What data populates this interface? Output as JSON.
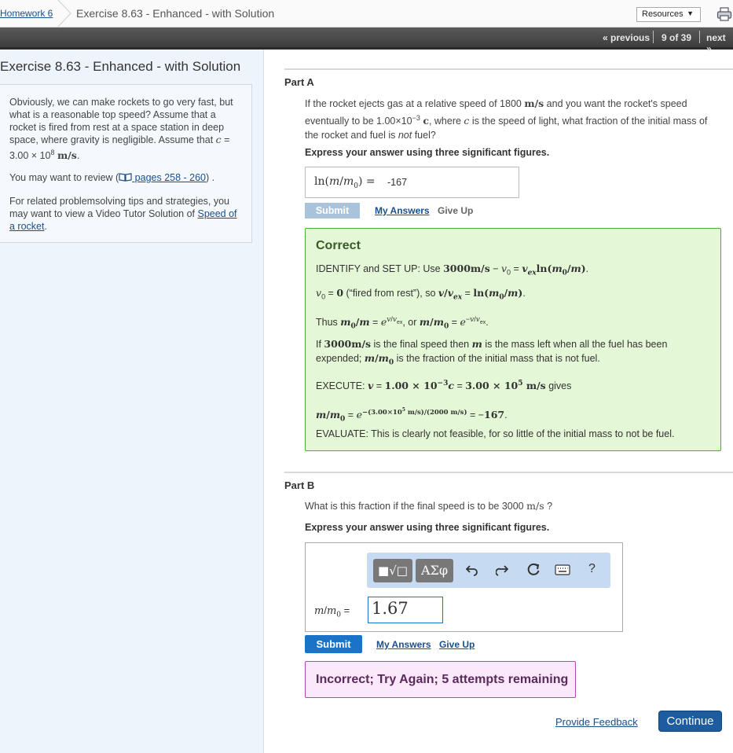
{
  "breadcrumb": {
    "home": "Homework 6",
    "current": "Exercise 8.63 - Enhanced - with Solution"
  },
  "resources": {
    "label": "Resources",
    "caret": "▼"
  },
  "nav": {
    "previous": "« previous",
    "position": "9 of 39",
    "next": "next »"
  },
  "sidebar": {
    "title": "Exercise 8.63 - Enhanced - with Solution",
    "intro": "Obviously, we can make rockets to go very fast, but what is a reasonable top speed? Assume that a rocket is fired from rest at a space station in deep space, where gravity is negligible. Assume that",
    "review_pre": "You may want to review (",
    "review_link": " pages 258 - 260",
    "review_post": ") .",
    "related_pre": "For related problemsolving tips and strategies, you may want to view a Video Tutor Solution of ",
    "related_link": "Speed of a rocket",
    "related_post": "."
  },
  "partA": {
    "heading": "Part A",
    "q_text": "If the rocket ejects gas at a relative speed of 1800",
    "instruction": "Express your answer using three significant figures.",
    "answer_value": "-167",
    "submit": "Submit",
    "my_answers": "My Answers",
    "give_up": "Give Up",
    "feedback": {
      "title": "Correct",
      "identify": "IDENTIFY and SET UP: Use",
      "evaluate": "EVALUATE: This is clearly not feasible, for so little of the initial mass to not be fuel."
    }
  },
  "partB": {
    "heading": "Part B",
    "q_text": "What is this fraction if the final speed is to be 3000",
    "instruction": "Express your answer using three significant figures.",
    "toolbar": {
      "templates": "■√□",
      "greek": "ΑΣφ",
      "help": "?"
    },
    "answer_value": "1.67",
    "submit": "Submit",
    "my_answers": "My Answers",
    "give_up": "Give Up",
    "result": "Incorrect; Try Again; 5 attempts remaining"
  },
  "footer": {
    "feedback": "Provide Feedback",
    "continue": "Continue"
  },
  "colors": {
    "correct_bg": "#e4f7d6",
    "correct_border": "#4caf3c",
    "incorrect_bg": "#fbe9fb",
    "incorrect_border": "#b04ab0",
    "primary": "#1a73c6"
  }
}
